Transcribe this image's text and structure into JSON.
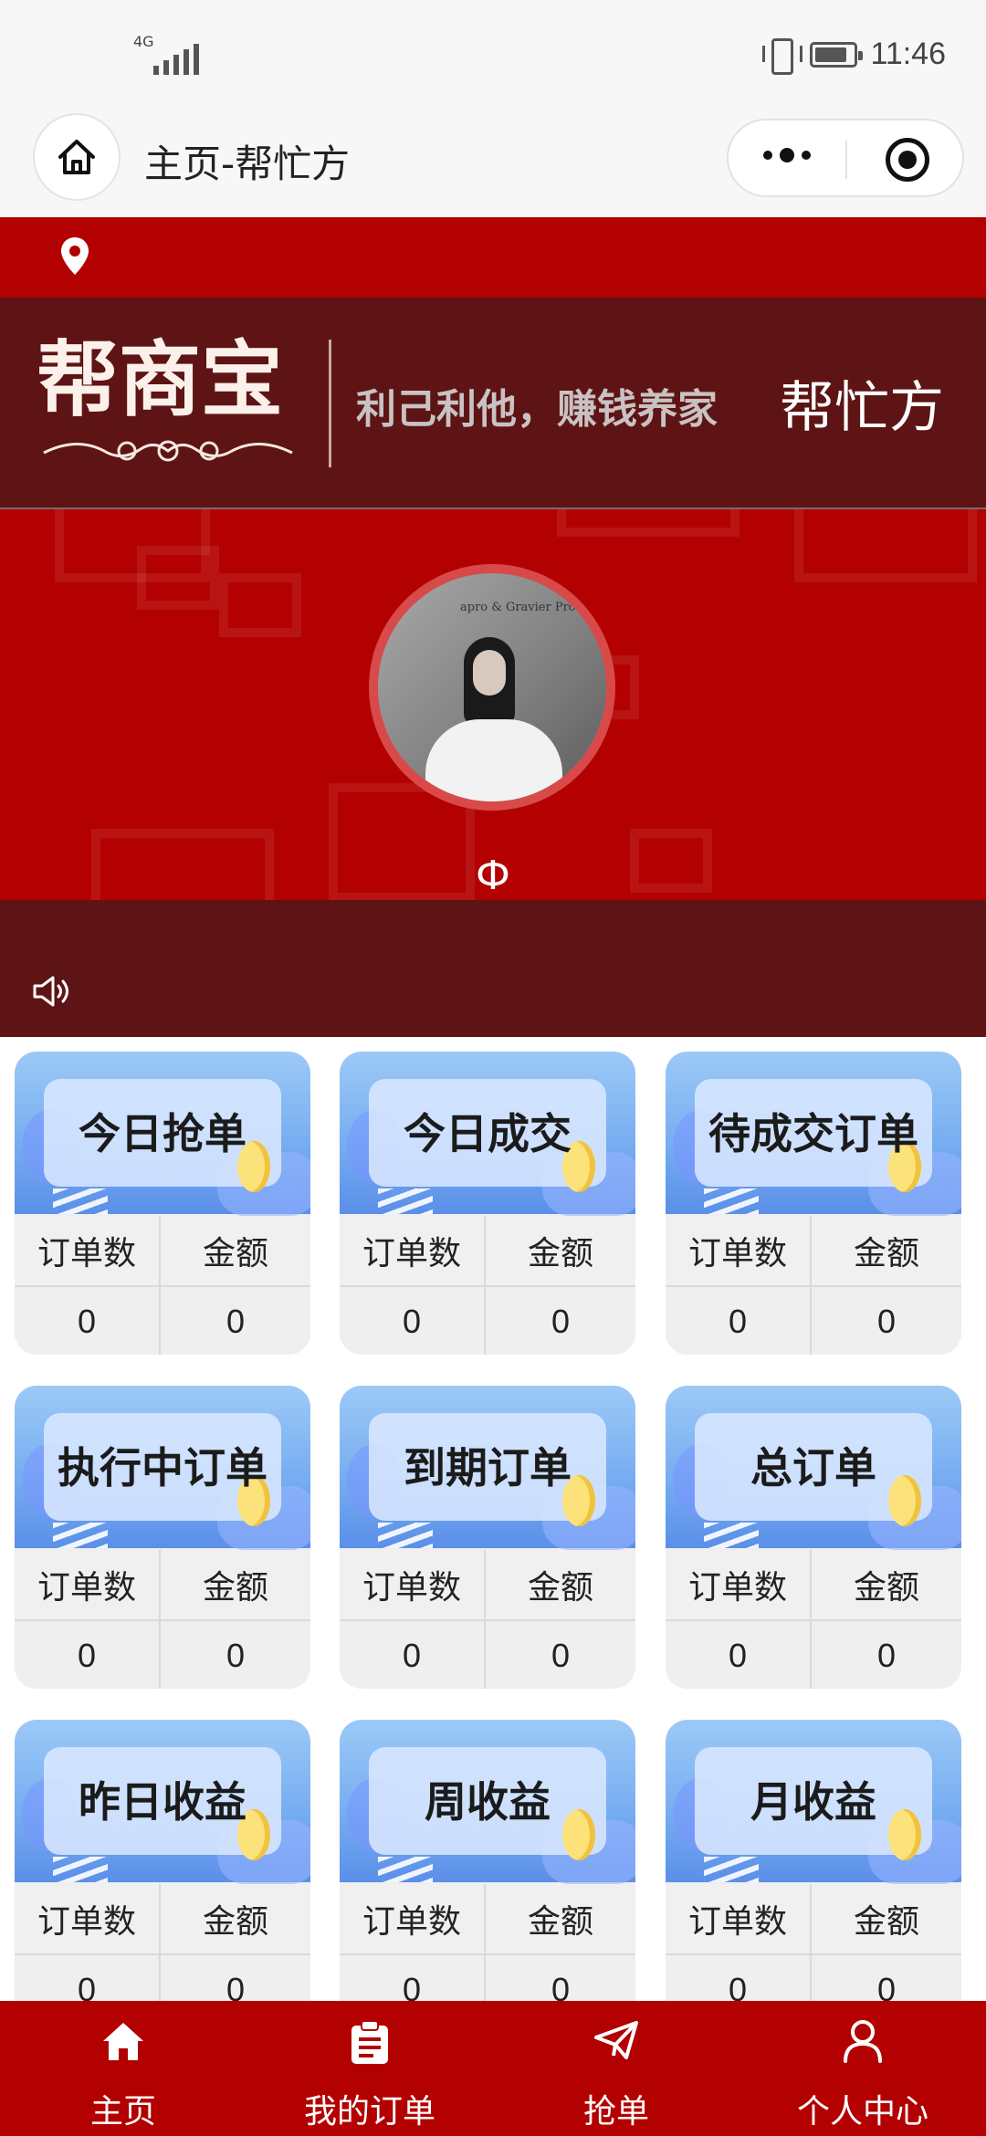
{
  "statusbar": {
    "network": "4G",
    "time": "11:46"
  },
  "navbar": {
    "title": "主页-帮忙方"
  },
  "banner": {
    "logo_text": "帮商宝",
    "slogan": "利己利他，赚钱养家",
    "brand": "帮忙方"
  },
  "profile": {
    "nickname": "Ф"
  },
  "cards": [
    {
      "title": "今日抢单",
      "col1": "订单数",
      "col2": "金额",
      "count": "0",
      "amount": "0"
    },
    {
      "title": "今日成交",
      "col1": "订单数",
      "col2": "金额",
      "count": "0",
      "amount": "0"
    },
    {
      "title": "待成交订单",
      "col1": "订单数",
      "col2": "金额",
      "count": "0",
      "amount": "0"
    },
    {
      "title": "执行中订单",
      "col1": "订单数",
      "col2": "金额",
      "count": "0",
      "amount": "0"
    },
    {
      "title": "到期订单",
      "col1": "订单数",
      "col2": "金额",
      "count": "0",
      "amount": "0"
    },
    {
      "title": "总订单",
      "col1": "订单数",
      "col2": "金额",
      "count": "0",
      "amount": "0"
    },
    {
      "title": "昨日收益",
      "col1": "订单数",
      "col2": "金额",
      "count": "0",
      "amount": "0"
    },
    {
      "title": "周收益",
      "col1": "订单数",
      "col2": "金额",
      "count": "0",
      "amount": "0"
    },
    {
      "title": "月收益",
      "col1": "订单数",
      "col2": "金额",
      "count": "0",
      "amount": "0"
    }
  ],
  "tabbar": {
    "items": [
      {
        "label": "主页",
        "icon": "home-icon"
      },
      {
        "label": "我的订单",
        "icon": "clipboard-icon"
      },
      {
        "label": "抢单",
        "icon": "paper-plane-icon"
      },
      {
        "label": "个人中心",
        "icon": "user-icon"
      }
    ]
  },
  "colors": {
    "primary_red": "#b30000",
    "dark_maroon": "#5e1414",
    "card_blue": "#78aef1"
  }
}
